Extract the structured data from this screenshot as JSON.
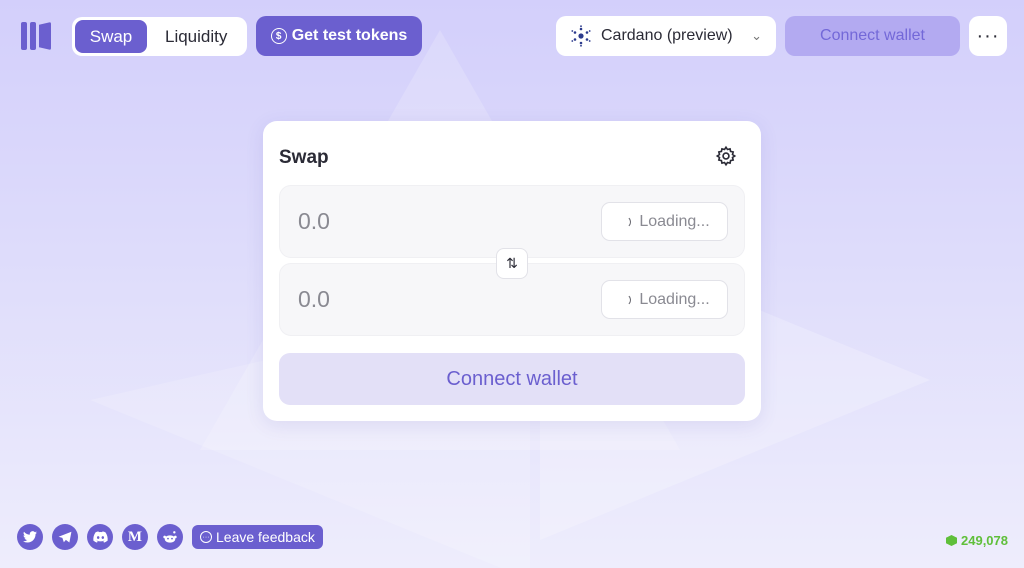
{
  "header": {
    "tabs": [
      {
        "label": "Swap",
        "active": true
      },
      {
        "label": "Liquidity",
        "active": false
      }
    ],
    "test_tokens_label": "Get test tokens",
    "network_label": "Cardano (preview)",
    "connect_wallet_label": "Connect wallet",
    "more_label": "···"
  },
  "swap": {
    "title": "Swap",
    "from": {
      "amount_placeholder": "0.0",
      "token_label": "Loading..."
    },
    "to": {
      "amount_placeholder": "0.0",
      "token_label": "Loading..."
    },
    "switch_label": "⇅",
    "connect_wallet_label": "Connect wallet"
  },
  "footer": {
    "socials": [
      "twitter-icon",
      "telegram-icon",
      "discord-icon",
      "medium-icon",
      "reddit-icon"
    ],
    "medium_letter": "M",
    "feedback_label": "Leave feedback",
    "block_height": "249,078"
  },
  "colors": {
    "accent": "#6b5fcf",
    "connect_disabled": "#b3aaf1",
    "block_green": "#5fbf3a",
    "background": "#d3cffb"
  }
}
